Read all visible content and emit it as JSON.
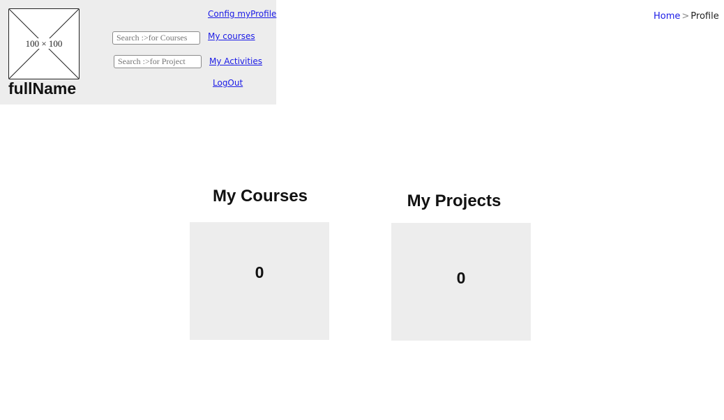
{
  "profile": {
    "avatar_placeholder": "100 × 100",
    "full_name": "fullName"
  },
  "search": {
    "courses_placeholder": "Search :>for Courses",
    "projects_placeholder": "Search :>for Project"
  },
  "nav": {
    "config_profile": "Config myProfile",
    "my_courses": "My courses",
    "my_activities": "My Activities",
    "logout": "LogOut"
  },
  "breadcrumb": {
    "home": "Home",
    "separator": ">",
    "current": "Profile"
  },
  "courses": {
    "title": "My Courses",
    "count": "0"
  },
  "projects": {
    "title": "My Projects",
    "count": "0"
  },
  "colors": {
    "panel_bg": "#ededed",
    "link": "#1a1ae6"
  }
}
